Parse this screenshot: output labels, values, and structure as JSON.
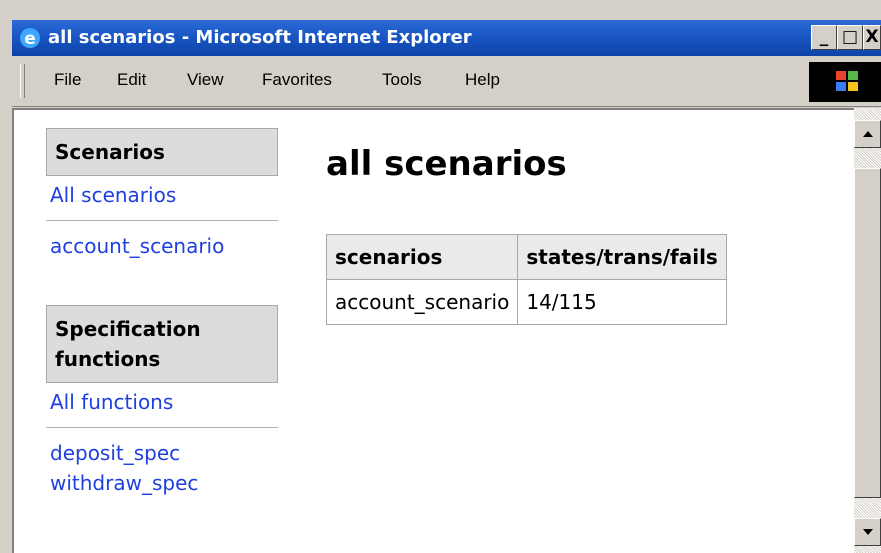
{
  "window": {
    "title": "all scenarios - Microsoft Internet Explorer",
    "minimize_label": "_",
    "maximize_label": "□",
    "close_label": "X"
  },
  "menu": {
    "items": [
      {
        "label": "File"
      },
      {
        "label": "Edit"
      },
      {
        "label": "View"
      },
      {
        "label": "Favorites"
      },
      {
        "label": "Tools"
      },
      {
        "label": "Help"
      }
    ]
  },
  "sidebar": {
    "scenarios_heading": "Scenarios",
    "scenario_links": [
      "All scenarios",
      "account_scenario"
    ],
    "functions_heading": "Specification functions",
    "function_links": [
      "All functions",
      "deposit_spec",
      "withdraw_spec"
    ]
  },
  "main": {
    "title": "all scenarios",
    "table": {
      "headers": [
        "scenarios",
        "states/trans/fails"
      ],
      "rows": [
        [
          "account_scenario",
          "14/115"
        ]
      ]
    }
  },
  "colors": {
    "titlebar": "#1a56c4",
    "link": "#1f3fdf",
    "chrome": "#d4d0c8"
  }
}
